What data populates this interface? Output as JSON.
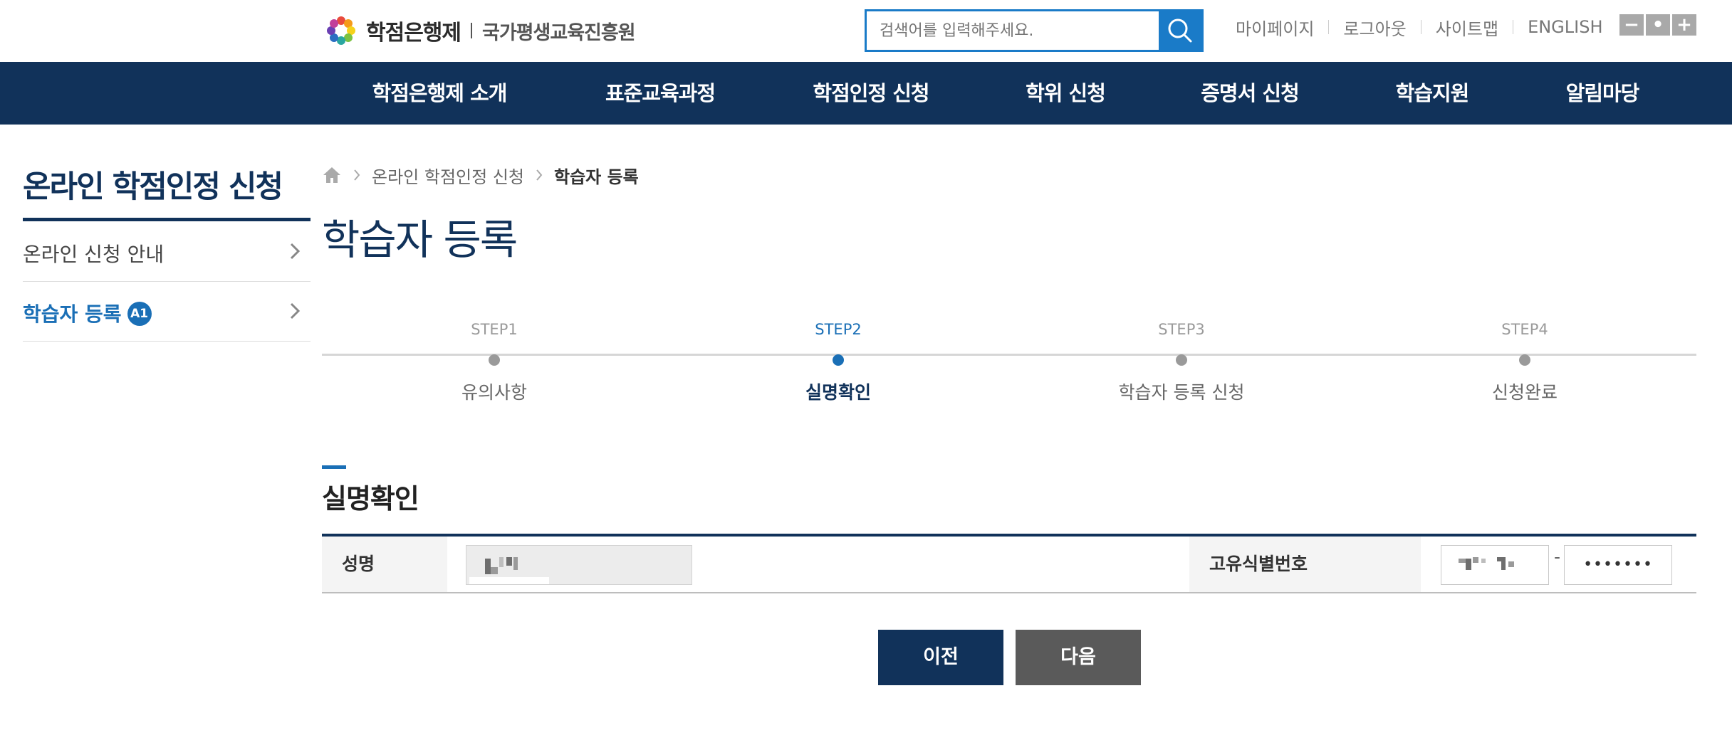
{
  "header": {
    "logo_main": "학점은행제",
    "logo_sub": "국가평생교육진흥원",
    "search": {
      "placeholder": "검색어를 입력해주세요."
    },
    "util_links": [
      "마이페이지",
      "로그아웃",
      "사이트맵",
      "ENGLISH"
    ],
    "zoom": [
      "−",
      "•",
      "+"
    ]
  },
  "nav": {
    "items": [
      "학점은행제 소개",
      "표준교육과정",
      "학점인정 신청",
      "학위 신청",
      "증명서 신청",
      "학습지원",
      "알림마당"
    ]
  },
  "sidebar": {
    "title": "온라인 학점인정 신청",
    "items": [
      {
        "label": "온라인 신청 안내"
      },
      {
        "label": "학습자 등록",
        "badge": "A1"
      }
    ]
  },
  "breadcrumb": {
    "items": [
      "온라인 학점인정 신청",
      "학습자 등록"
    ]
  },
  "page_title": "학습자 등록",
  "steps": [
    {
      "num": "STEP1",
      "name": "유의사항"
    },
    {
      "num": "STEP2",
      "name": "실명확인"
    },
    {
      "num": "STEP3",
      "name": "학습자 등록 신청"
    },
    {
      "num": "STEP4",
      "name": "신청완료"
    }
  ],
  "section": {
    "title": "실명확인",
    "name_label": "성명",
    "id_label": "고유식별번호",
    "id_separator": "-",
    "id_back_masked": "•••••••"
  },
  "buttons": {
    "prev": "이전",
    "next": "다음"
  },
  "colors": {
    "navy": "#11325a",
    "blue": "#1a6fb6",
    "search_blue": "#1a7bc8",
    "grey_button": "#5a5a5a"
  }
}
